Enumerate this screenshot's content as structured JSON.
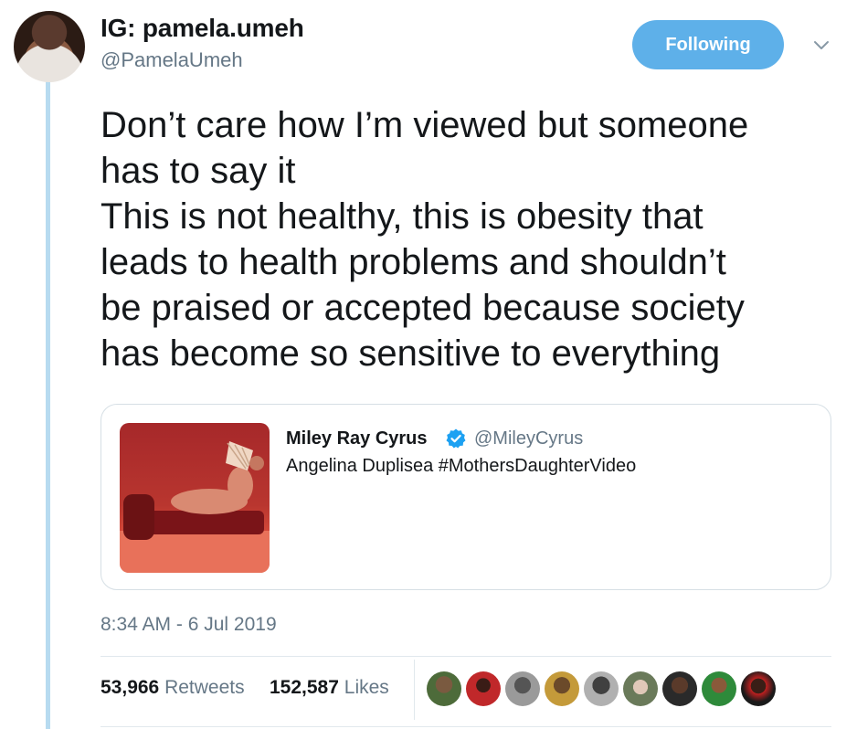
{
  "author": {
    "display_name": "IG: pamela.umeh",
    "handle": "@PamelaUmeh"
  },
  "follow_button": {
    "label": "Following"
  },
  "tweet": {
    "lines": [
      "Don’t care how I’m viewed but someone",
      "has to say it",
      "This is not healthy, this is obesity that",
      "leads to health problems and shouldn’t",
      "be praised or accepted because society",
      "has become so sensitive to everything"
    ]
  },
  "quoted": {
    "name": "Miley Ray Cyrus",
    "handle": "@MileyCyrus",
    "text": "Angelina Duplisea #MothersDaughterVideo"
  },
  "timestamp": "8:34 AM - 6 Jul 2019",
  "stats": {
    "retweets_count": "53,966",
    "retweets_label": "Retweets",
    "likes_count": "152,587",
    "likes_label": "Likes"
  },
  "colors": {
    "accent": "#5eb0e9",
    "thread_line": "#b7dbf0",
    "secondary_text": "#657786",
    "verified": "#1da1f2"
  },
  "icons": [
    "chevron-down-icon",
    "verified-badge-icon"
  ]
}
